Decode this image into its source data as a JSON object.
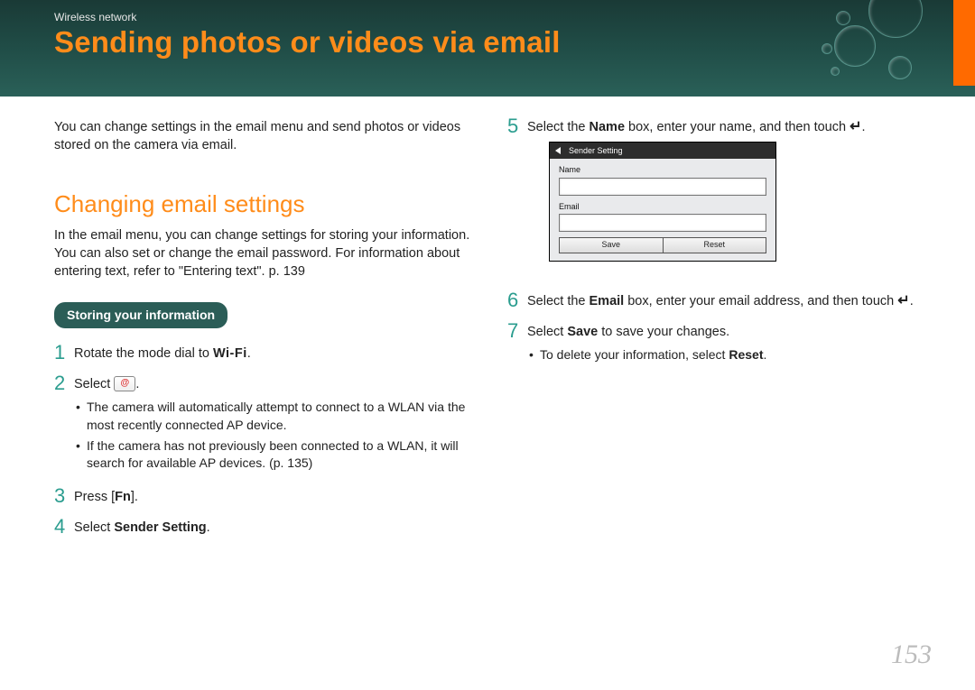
{
  "header": {
    "chapter": "Wireless network",
    "title": "Sending photos or videos via email"
  },
  "left": {
    "intro": "You can change settings in the email menu and send photos or videos stored on the camera via email.",
    "section_heading": "Changing email settings",
    "section_desc": "In the email menu, you can change settings for storing your information. You can also set or change the email password. For information about entering text, refer to \"Entering text\". p. 139",
    "pill": "Storing your information",
    "step1_pre": "Rotate the mode dial to ",
    "wifi_label": "Wi-Fi",
    "step2_pre": "Select ",
    "step2_sub1": "The camera will automatically attempt to connect to a WLAN via the most recently connected AP device.",
    "step2_sub2": "If the camera has not previously been connected to a WLAN, it will search for available AP devices. (p. 135)",
    "step3_pre": "Press [",
    "step3_fn": "Fn",
    "step3_post": "].",
    "step4_pre": "Select ",
    "step4_bold": "Sender Setting",
    "step4_post": "."
  },
  "right": {
    "step5_pre": "Select the ",
    "step5_bold": "Name",
    "step5_mid": " box, enter your name, and then touch ",
    "senderbox": {
      "title": "Sender Setting",
      "label_name": "Name",
      "label_email": "Email",
      "btn_save": "Save",
      "btn_reset": "Reset"
    },
    "step6_pre": "Select the ",
    "step6_bold": "Email",
    "step6_mid": " box, enter your email address, and then touch ",
    "step7_pre": "Select ",
    "step7_bold": "Save",
    "step7_post": " to save your changes.",
    "step7_sub_pre": "To delete your information, select ",
    "step7_sub_bold": "Reset",
    "step7_sub_post": "."
  },
  "pagenum": "153"
}
